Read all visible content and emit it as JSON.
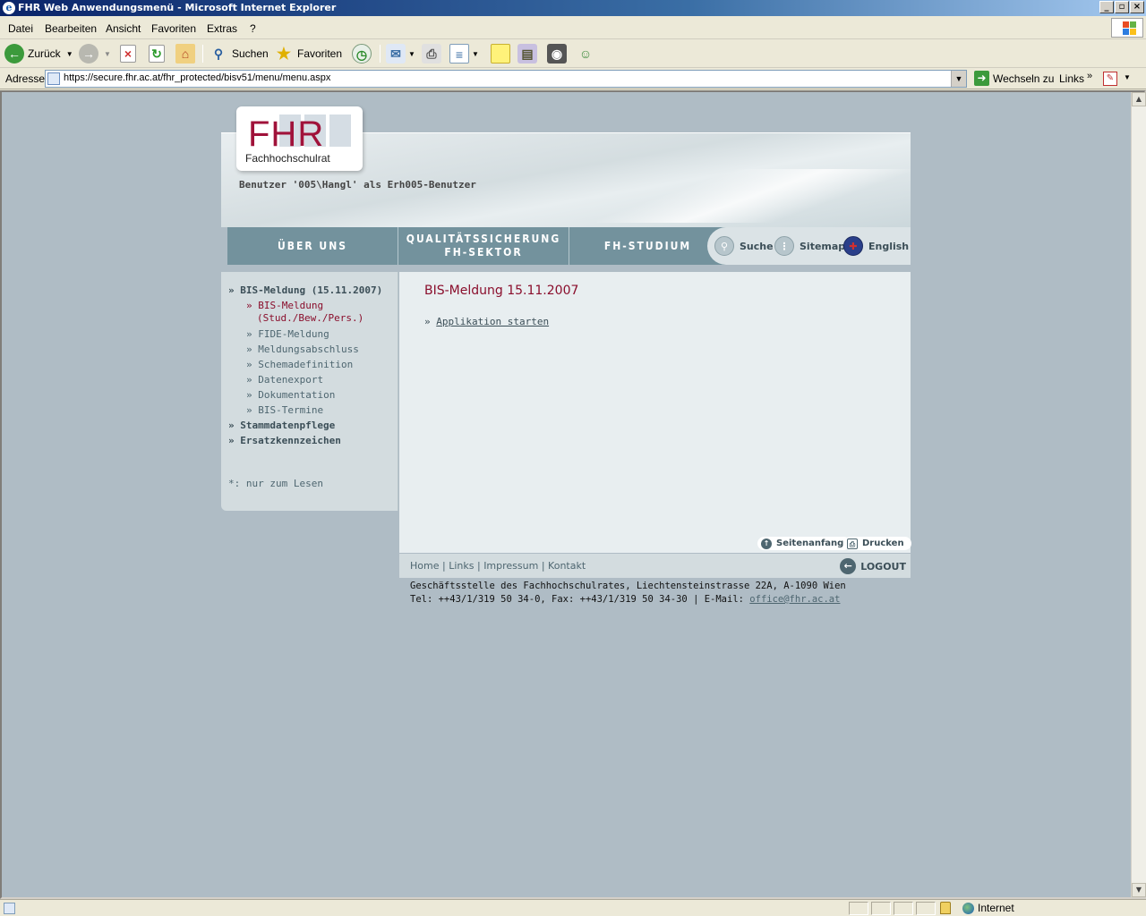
{
  "window": {
    "title": "FHR Web Anwendungsmenü - Microsoft Internet Explorer",
    "buttons": [
      "_",
      "▫",
      "×"
    ]
  },
  "menubar": {
    "items": [
      "Datei",
      "Bearbeiten",
      "Ansicht",
      "Favoriten",
      "Extras",
      "?"
    ]
  },
  "toolbar": {
    "back_label": "Zurück",
    "search_label": "Suchen",
    "favorites_label": "Favoriten"
  },
  "addressbar": {
    "label": "Adresse",
    "url": "https://secure.fhr.ac.at/fhr_protected/bisv51/menu/menu.aspx",
    "go_label": "Wechseln zu",
    "links_label": "Links"
  },
  "statusbar": {
    "zone": "Internet"
  },
  "page": {
    "logo": {
      "word": "FHR",
      "subtitle": "Fachhochschulrat"
    },
    "user_line": "Benutzer '005\\Hangl' als Erh005-Benutzer",
    "nav": {
      "tabs": [
        {
          "line1": "ÜBER UNS",
          "line2": ""
        },
        {
          "line1": "QUALITÄTSSICHERUNG",
          "line2": "FH-SEKTOR"
        },
        {
          "line1": "FH-STUDIUM",
          "line2": ""
        }
      ],
      "tools": {
        "search": "Suche",
        "sitemap": "Sitemap",
        "english": "English"
      }
    },
    "sidebar": {
      "groups": [
        {
          "label": "» BIS-Meldung (15.11.2007)"
        },
        {
          "label": "» Stammdatenpflege"
        },
        {
          "label": "» Ersatzkennzeichen"
        }
      ],
      "sub_items": [
        {
          "label": "» BIS-Meldung",
          "label2": "(Stud./Bew./Pers.)"
        },
        {
          "label": "» FIDE-Meldung"
        },
        {
          "label": "» Meldungsabschluss"
        },
        {
          "label": "» Schemadefinition"
        },
        {
          "label": "» Datenexport"
        },
        {
          "label": "» Dokumentation"
        },
        {
          "label": "» BIS-Termine"
        }
      ],
      "note": "*: nur zum Lesen"
    },
    "main": {
      "heading": "BIS-Meldung 15.11.2007",
      "link_prefix": "»",
      "link_text": "Applikation starten",
      "top_button": "Seitenanfang",
      "print_button": "Drucken"
    },
    "footer": {
      "links": [
        "Home",
        "Links",
        "Impressum",
        "Kontakt"
      ],
      "separator": "|",
      "logout": "LOGOUT",
      "address_line1": "Geschäftsstelle des Fachhochschulrates, Liechtensteinstrasse 22A, A-1090 Wien",
      "address_line2_prefix": "Tel: ++43/1/319 50 34-0, Fax: ++43/1/319 50 34-30 | E-Mail: ",
      "email": "office@fhr.ac.at"
    }
  },
  "colors": {
    "brand_red": "#a0123a",
    "nav_blue": "#73929d",
    "page_bg": "#afbcc5"
  }
}
